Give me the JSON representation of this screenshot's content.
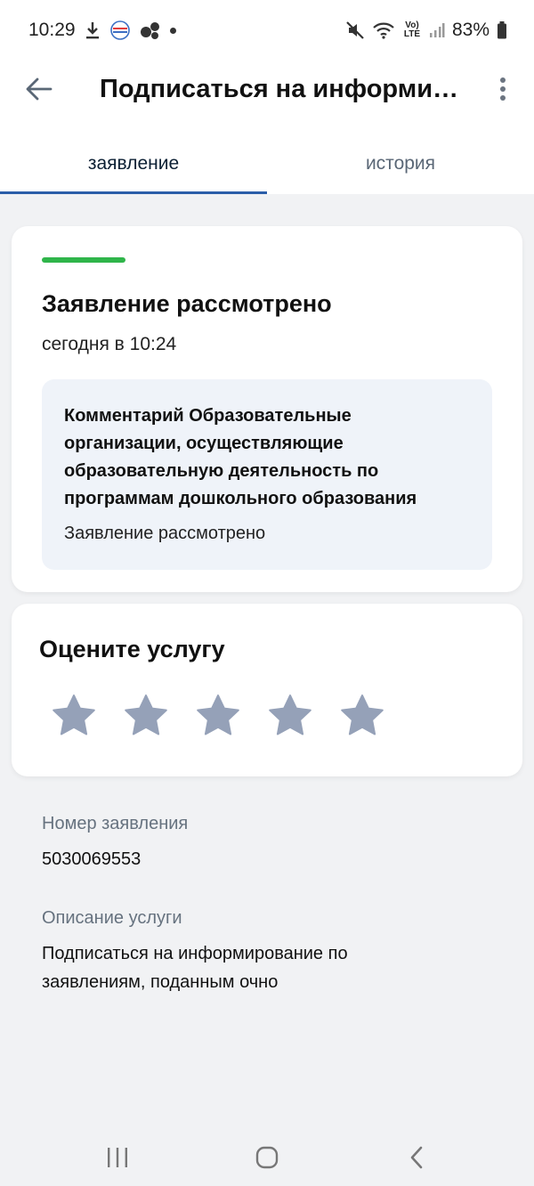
{
  "status_bar": {
    "time": "10:29",
    "battery": "83%",
    "volte_label": "Vo) LTE",
    "icons": [
      "download-icon",
      "gosuslugi-icon",
      "app-icon",
      "dot-icon",
      "mute-icon",
      "wifi-icon",
      "volte-icon",
      "signal-icon",
      "battery-icon"
    ]
  },
  "app_bar": {
    "title": "Подписаться на информирование по заявлениям, поданным очно",
    "back_icon": "arrow-left-icon",
    "more_icon": "more-vertical-icon"
  },
  "tabs": [
    {
      "label": "заявление",
      "active": true
    },
    {
      "label": "история",
      "active": false
    }
  ],
  "status_card": {
    "accent_color": "#2fb54a",
    "title": "Заявление рассмотрено",
    "time": "сегодня в 10:24",
    "comment": {
      "heading": "Комментарий Образовательные организации, осуществляющие образовательную деятельность по программам дошкольного образования",
      "text": "Заявление рассмотрено"
    }
  },
  "rating": {
    "title": "Оцените услугу",
    "max_stars": 5,
    "selected": 0,
    "star_color": "#95a1b8"
  },
  "details": {
    "number_label": "Номер заявления",
    "number_value": "5030069553",
    "description_label": "Описание услуги",
    "description_value": "Подписаться на информирование по заявлениям, поданным очно"
  },
  "nav_bar": {
    "icons": [
      "recent-apps-icon",
      "home-icon",
      "back-nav-icon"
    ]
  }
}
